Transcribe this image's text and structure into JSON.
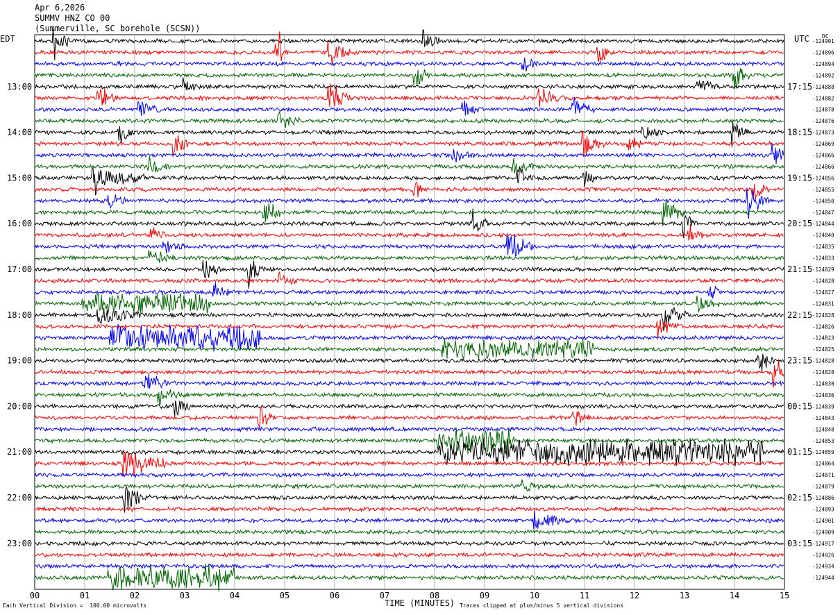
{
  "header": {
    "date": "Apr 6,2026",
    "station": "SUMMV HNZ CO 00",
    "location": "(Summerville, SC borehole (SCSN))"
  },
  "left_tz": "EDT",
  "right_tz": "UTC",
  "dc_label": "DC",
  "footer": {
    "scale": "Each Vertical Division =  100.00 microvolts",
    "xlabel": "TIME (MINUTES)",
    "clip": "Traces clipped at plus/minus 5 vertical divisions"
  },
  "colors": {
    "black": "#000000",
    "red": "#ff0000",
    "blue": "#0000ff",
    "green": "#006400",
    "grid": "#808080"
  },
  "chart_data": {
    "type": "line",
    "xlabel": "TIME (MINUTES)",
    "xlim": [
      0,
      15
    ],
    "x_ticks": [
      "00",
      "01",
      "02",
      "03",
      "04",
      "05",
      "06",
      "07",
      "08",
      "09",
      "10",
      "11",
      "12",
      "13",
      "14",
      "15"
    ],
    "left_ticks": [
      "13:00",
      "14:00",
      "15:00",
      "16:00",
      "17:00",
      "18:00",
      "19:00",
      "20:00",
      "21:00",
      "22:00",
      "23:00"
    ],
    "right_ticks": [
      "17:15",
      "18:15",
      "19:15",
      "20:15",
      "21:15",
      "22:15",
      "23:15",
      "00:15",
      "01:15",
      "02:15",
      "03:15"
    ],
    "trace_colors": [
      "black",
      "red",
      "blue",
      "green"
    ],
    "dc_offsets": [
      "-124901",
      "-124896",
      "-124894",
      "-124892",
      "-124888",
      "-124882",
      "-124878",
      "-124876",
      "-124873",
      "-124869",
      "-124866",
      "-124866",
      "-124856",
      "-124855",
      "-124850",
      "-124847",
      "-124844",
      "-124840",
      "-124835",
      "-124833",
      "-124829",
      "-124828",
      "-124827",
      "-124831",
      "-124828",
      "-124826",
      "-124823",
      "-124825",
      "-124828",
      "-124828",
      "-124830",
      "-124836",
      "-124839",
      "-124843",
      "-124848",
      "-124853",
      "-124859",
      "-124864",
      "-124871",
      "-124879",
      "-124886",
      "-124893",
      "-124901",
      "-124909",
      "-124917",
      "-124926",
      "-124934",
      "-124944"
    ],
    "events": [
      {
        "trace": 0,
        "minute": 0.4,
        "amp": 4,
        "dur": 0.3
      },
      {
        "trace": 0,
        "minute": 7.8,
        "amp": 3,
        "dur": 0.3
      },
      {
        "trace": 1,
        "minute": 4.85,
        "amp": 5,
        "dur": 0.2
      },
      {
        "trace": 1,
        "minute": 5.9,
        "amp": 3,
        "dur": 0.4
      },
      {
        "trace": 1,
        "minute": 11.3,
        "amp": 3,
        "dur": 0.2
      },
      {
        "trace": 2,
        "minute": 9.8,
        "amp": 1.5,
        "dur": 0.3
      },
      {
        "trace": 3,
        "minute": 7.6,
        "amp": 3,
        "dur": 0.3
      },
      {
        "trace": 3,
        "minute": 14.0,
        "amp": 3,
        "dur": 0.3
      },
      {
        "trace": 4,
        "minute": 3.0,
        "amp": 2,
        "dur": 0.3
      },
      {
        "trace": 4,
        "minute": 13.3,
        "amp": 1.5,
        "dur": 0.4
      },
      {
        "trace": 5,
        "minute": 1.3,
        "amp": 2.5,
        "dur": 0.4
      },
      {
        "trace": 5,
        "minute": 5.9,
        "amp": 3,
        "dur": 0.5
      },
      {
        "trace": 5,
        "minute": 10.1,
        "amp": 2,
        "dur": 0.5
      },
      {
        "trace": 6,
        "minute": 2.1,
        "amp": 2,
        "dur": 0.4
      },
      {
        "trace": 6,
        "minute": 8.6,
        "amp": 1.5,
        "dur": 0.4
      },
      {
        "trace": 6,
        "minute": 10.8,
        "amp": 2.5,
        "dur": 0.4
      },
      {
        "trace": 7,
        "minute": 4.9,
        "amp": 2,
        "dur": 0.4
      },
      {
        "trace": 8,
        "minute": 1.7,
        "amp": 2,
        "dur": 0.3
      },
      {
        "trace": 8,
        "minute": 12.2,
        "amp": 1.5,
        "dur": 0.4
      },
      {
        "trace": 8,
        "minute": 14.0,
        "amp": 2.5,
        "dur": 0.3
      },
      {
        "trace": 9,
        "minute": 2.8,
        "amp": 3,
        "dur": 0.3
      },
      {
        "trace": 9,
        "minute": 11.0,
        "amp": 3,
        "dur": 0.4
      },
      {
        "trace": 9,
        "minute": 11.9,
        "amp": 2,
        "dur": 0.3
      },
      {
        "trace": 10,
        "minute": 8.4,
        "amp": 2,
        "dur": 0.4
      },
      {
        "trace": 10,
        "minute": 14.8,
        "amp": 2,
        "dur": 0.4
      },
      {
        "trace": 11,
        "minute": 2.3,
        "amp": 1.5,
        "dur": 0.4
      },
      {
        "trace": 11,
        "minute": 9.6,
        "amp": 2,
        "dur": 0.4
      },
      {
        "trace": 12,
        "minute": 1.2,
        "amp": 2.5,
        "dur": 1.0
      },
      {
        "trace": 12,
        "minute": 9.7,
        "amp": 3,
        "dur": 0.3
      },
      {
        "trace": 12,
        "minute": 11.0,
        "amp": 3,
        "dur": 0.2
      },
      {
        "trace": 13,
        "minute": 7.6,
        "amp": 2,
        "dur": 0.3
      },
      {
        "trace": 13,
        "minute": 14.4,
        "amp": 2,
        "dur": 0.3
      },
      {
        "trace": 14,
        "minute": 1.5,
        "amp": 2,
        "dur": 0.3
      },
      {
        "trace": 14,
        "minute": 14.3,
        "amp": 3,
        "dur": 0.4
      },
      {
        "trace": 15,
        "minute": 4.6,
        "amp": 4,
        "dur": 0.3
      },
      {
        "trace": 15,
        "minute": 12.6,
        "amp": 3,
        "dur": 0.4
      },
      {
        "trace": 16,
        "minute": 8.8,
        "amp": 2.5,
        "dur": 0.3
      },
      {
        "trace": 16,
        "minute": 13.0,
        "amp": 2,
        "dur": 0.3
      },
      {
        "trace": 17,
        "minute": 2.3,
        "amp": 2,
        "dur": 0.3
      },
      {
        "trace": 17,
        "minute": 13.1,
        "amp": 2,
        "dur": 0.3
      },
      {
        "trace": 18,
        "minute": 2.6,
        "amp": 2,
        "dur": 0.4
      },
      {
        "trace": 18,
        "minute": 9.5,
        "amp": 3,
        "dur": 0.5
      },
      {
        "trace": 19,
        "minute": 2.3,
        "amp": 2,
        "dur": 0.5
      },
      {
        "trace": 20,
        "minute": 3.4,
        "amp": 2,
        "dur": 0.3
      },
      {
        "trace": 20,
        "minute": 4.3,
        "amp": 3,
        "dur": 0.3
      },
      {
        "trace": 21,
        "minute": 4.9,
        "amp": 2,
        "dur": 0.3
      },
      {
        "trace": 22,
        "minute": 3.6,
        "amp": 2,
        "dur": 0.3
      },
      {
        "trace": 22,
        "minute": 13.5,
        "amp": 1.5,
        "dur": 0.3
      },
      {
        "trace": 23,
        "minute": 1.0,
        "amp": 1.5,
        "dur": 2.5
      },
      {
        "trace": 23,
        "minute": 13.3,
        "amp": 2,
        "dur": 0.4
      },
      {
        "trace": 24,
        "minute": 1.3,
        "amp": 2,
        "dur": 0.8
      },
      {
        "trace": 24,
        "minute": 12.6,
        "amp": 3,
        "dur": 0.5
      },
      {
        "trace": 25,
        "minute": 12.5,
        "amp": 2,
        "dur": 0.4
      },
      {
        "trace": 26,
        "minute": 1.5,
        "amp": 2,
        "dur": 3.0
      },
      {
        "trace": 27,
        "minute": 8.2,
        "amp": 1.5,
        "dur": 3.0
      },
      {
        "trace": 28,
        "minute": 14.5,
        "amp": 3,
        "dur": 0.3
      },
      {
        "trace": 29,
        "minute": 14.8,
        "amp": 3,
        "dur": 0.3
      },
      {
        "trace": 30,
        "minute": 2.2,
        "amp": 2,
        "dur": 0.6
      },
      {
        "trace": 31,
        "minute": 2.5,
        "amp": 2,
        "dur": 0.4
      },
      {
        "trace": 32,
        "minute": 2.8,
        "amp": 2,
        "dur": 0.3
      },
      {
        "trace": 33,
        "minute": 4.5,
        "amp": 3,
        "dur": 0.3
      },
      {
        "trace": 33,
        "minute": 10.8,
        "amp": 2,
        "dur": 0.3
      },
      {
        "trace": 35,
        "minute": 8.1,
        "amp": 2,
        "dur": 1.5
      },
      {
        "trace": 36,
        "minute": 8.1,
        "amp": 2,
        "dur": 6.5
      },
      {
        "trace": 37,
        "minute": 1.8,
        "amp": 4,
        "dur": 0.8
      },
      {
        "trace": 39,
        "minute": 9.8,
        "amp": 1.5,
        "dur": 0.3
      },
      {
        "trace": 40,
        "minute": 1.8,
        "amp": 3,
        "dur": 0.5
      },
      {
        "trace": 42,
        "minute": 10.0,
        "amp": 2,
        "dur": 0.8
      },
      {
        "trace": 47,
        "minute": 1.5,
        "amp": 2,
        "dur": 2.5
      }
    ]
  }
}
